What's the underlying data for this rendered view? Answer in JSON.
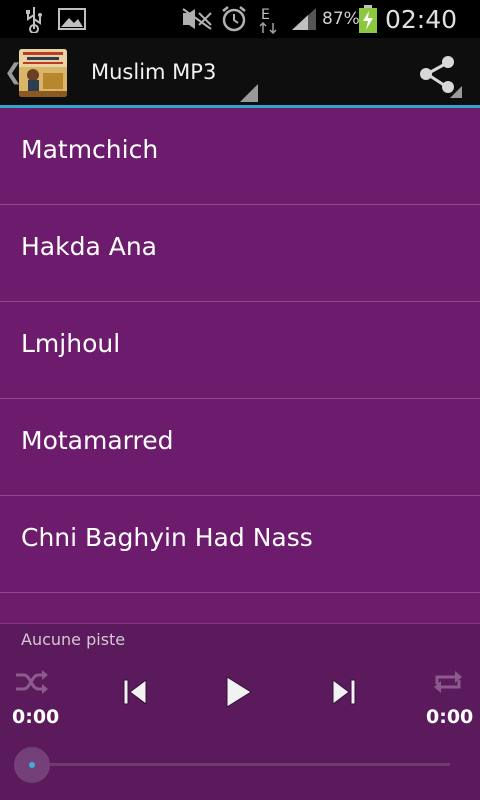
{
  "status_bar": {
    "battery_percent": "87%",
    "time": "02:40",
    "network_type": "E",
    "icons": [
      "usb-icon",
      "image-icon",
      "mute-icon",
      "alarm-icon",
      "network-icon",
      "signal-icon",
      "battery-charging-icon"
    ]
  },
  "action_bar": {
    "title": "Muslim MP3",
    "share_icon": "share-icon"
  },
  "tracks": [
    {
      "title": "Matmchich"
    },
    {
      "title": "Hakda Ana"
    },
    {
      "title": "Lmjhoul"
    },
    {
      "title": "Motamarred"
    },
    {
      "title": "Chni Baghyin Had Nass"
    }
  ],
  "player": {
    "now_playing": "Aucune piste",
    "elapsed": "0:00",
    "duration": "0:00",
    "progress": 0,
    "controls": [
      "shuffle-icon",
      "previous-icon",
      "play-icon",
      "next-icon",
      "repeat-icon"
    ]
  },
  "colors": {
    "list_background": "#6c1b6d",
    "player_background": "#5a1a5b",
    "accent": "#33a6cc"
  }
}
